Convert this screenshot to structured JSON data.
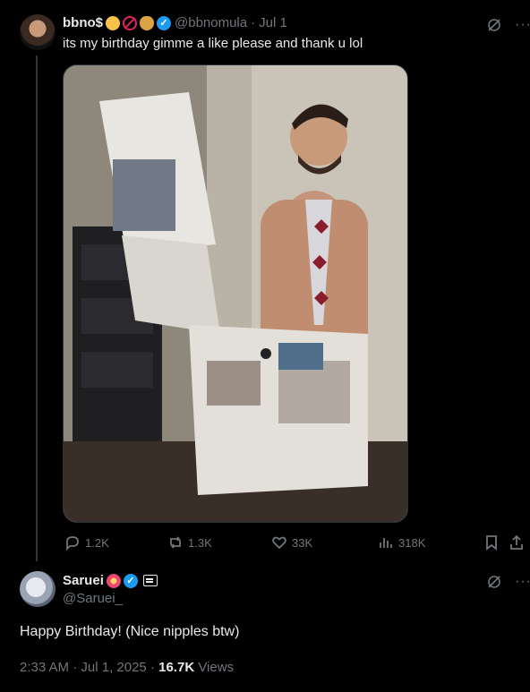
{
  "tweet": {
    "display_name": "bbno$",
    "handle": "@bbnomula",
    "separator": "·",
    "date": "Jul 1",
    "text": "its my birthday gimme a like please and thank u lol",
    "stats": {
      "replies": "1.2K",
      "reposts": "1.3K",
      "likes": "33K",
      "views": "318K"
    }
  },
  "reply": {
    "display_name": "Saruei",
    "handle": "@Saruei_",
    "text": "Happy Birthday! (Nice nipples btw)",
    "time": "2:33 AM",
    "date": "Jul 1, 2025",
    "views_count": "16.7K",
    "views_label": "Views"
  },
  "colors": {
    "background": "#000000",
    "text": "#e7e9ea",
    "muted": "#71767b",
    "verified": "#1d9bf0",
    "divider": "#2f3336"
  },
  "icons": [
    "grok-icon",
    "more-icon",
    "reply-icon",
    "repost-icon",
    "like-icon",
    "views-icon",
    "bookmark-icon",
    "share-icon",
    "verified-icon",
    "stop-emoji-icon",
    "baby-emoji-icon",
    "money-bag-icon",
    "collision-emoji-icon",
    "badge-icon"
  ]
}
